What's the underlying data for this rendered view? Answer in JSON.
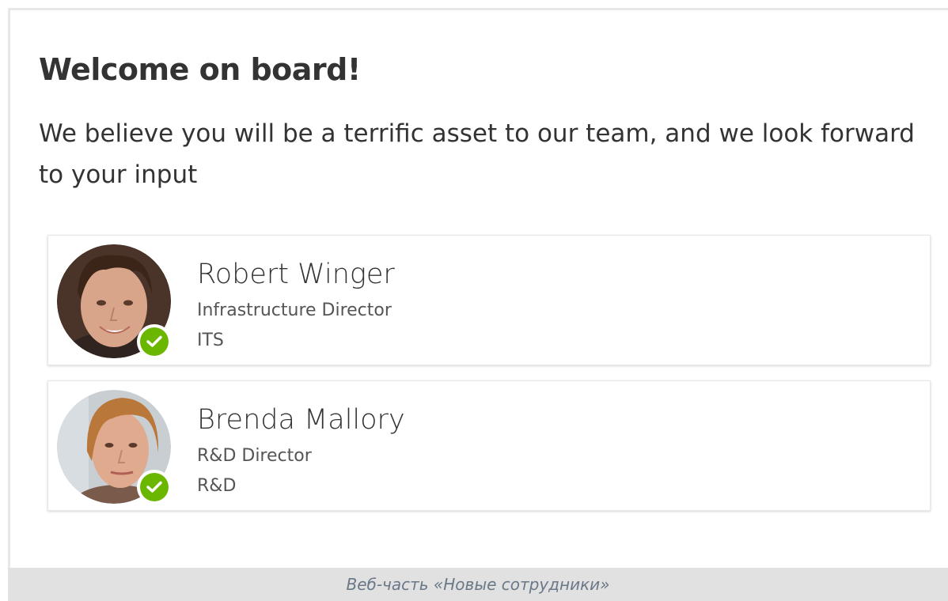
{
  "welcome": {
    "title": "Welcome on board!",
    "message": "We believe you will be a terrific asset to our team, and we look forward to your input"
  },
  "people": [
    {
      "name": "Robert Winger",
      "title": "Infrastructure Director",
      "department": "ITS",
      "presence": "available",
      "presence_color": "#6bb700"
    },
    {
      "name": "Brenda Mallory",
      "title": "R&D Director",
      "department": "R&D",
      "presence": "available",
      "presence_color": "#6bb700"
    }
  ],
  "caption": "Веб-часть «Новые сотрудники»",
  "icons": {
    "presence": "checkmark-circle-icon"
  }
}
